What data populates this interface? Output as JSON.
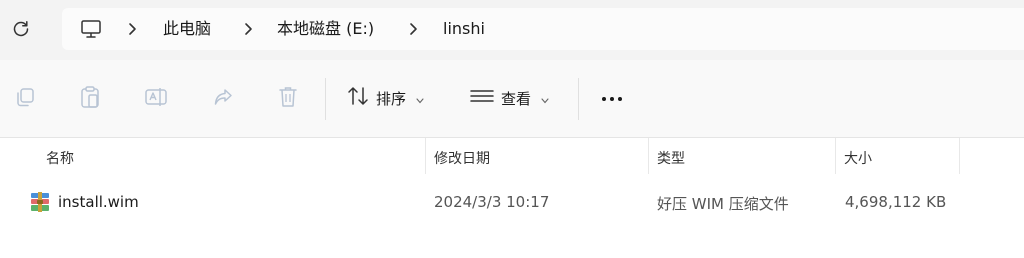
{
  "breadcrumb": {
    "items": [
      "此电脑",
      "本地磁盘 (E:)",
      "linshi"
    ]
  },
  "toolbar": {
    "sort_label": "排序",
    "view_label": "查看"
  },
  "columns": [
    "名称",
    "修改日期",
    "类型",
    "大小"
  ],
  "files": [
    {
      "name": "install.wim",
      "modified": "2024/3/3 10:17",
      "type": "好压 WIM 压缩文件",
      "size": "4,698,112 KB"
    }
  ],
  "icons": {
    "refresh": "refresh-icon",
    "pc": "computer-icon",
    "copy": "copy-icon",
    "paste": "paste-icon",
    "rename": "rename-icon",
    "share": "share-icon",
    "delete": "delete-icon",
    "sort": "sort-icon",
    "view": "view-icon",
    "more": "more-icon",
    "file": "archive-file-icon"
  },
  "colors": {
    "topbar_bg": "#f3f3f3",
    "address_bg": "#fbfbfb",
    "toolbar_bg": "#f9f9f9",
    "disabled_icon": "#b8c4d4"
  }
}
